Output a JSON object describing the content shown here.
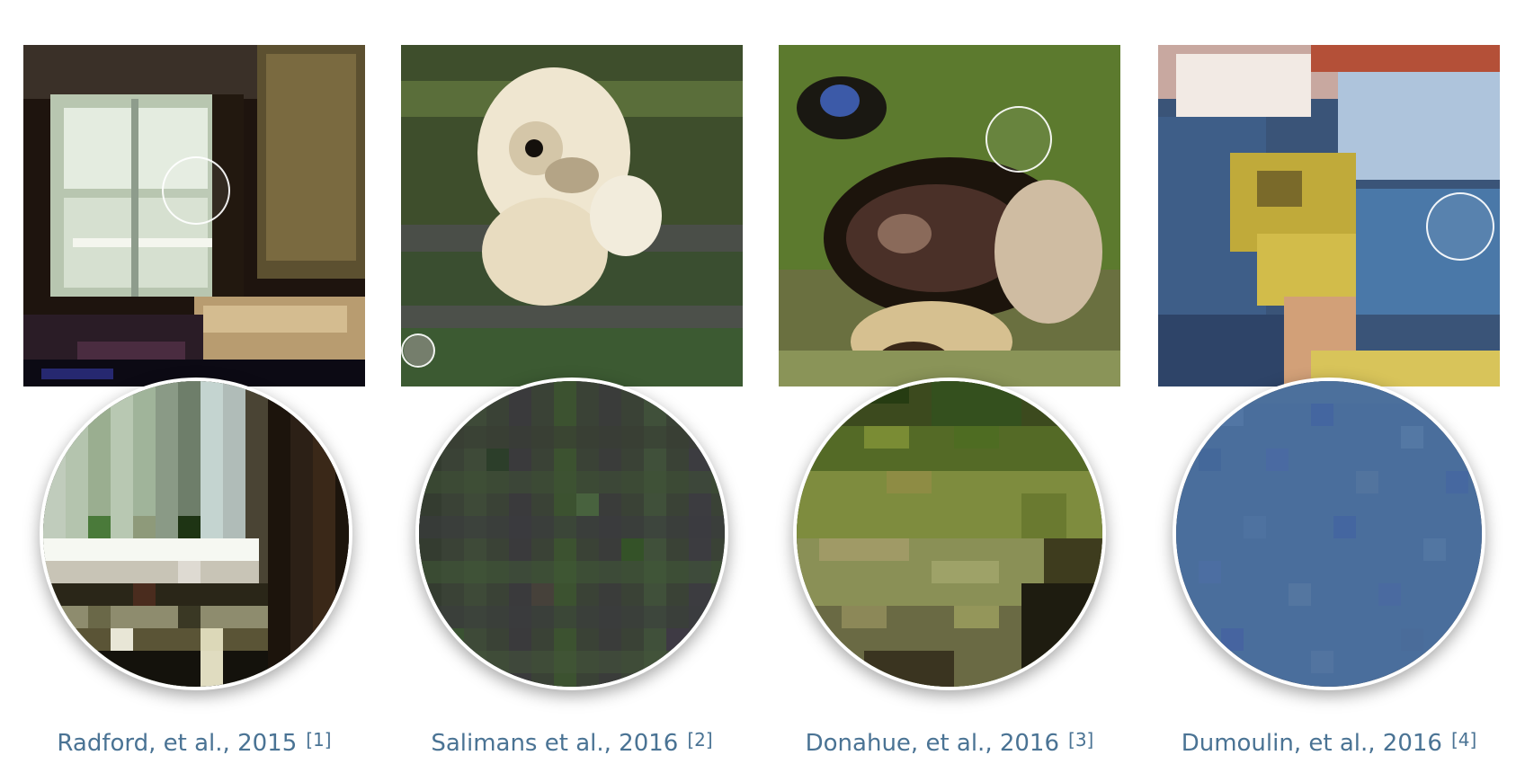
{
  "figures": [
    {
      "caption": "Radford, et al., 2015",
      "ref": "[1]",
      "scene": "bedroom-window",
      "palette": {
        "dark": "#14100c",
        "light": "#d8e4d4",
        "mid": "#8a7a5a",
        "accent": "#3d6b3a"
      }
    },
    {
      "caption": "Salimans et al., 2016",
      "ref": "[2]",
      "scene": "white-animal-fence",
      "palette": {
        "dark": "#343a33",
        "light": "#f1ead7",
        "mid": "#48593d",
        "accent": "#3e5a37"
      }
    },
    {
      "caption": "Donahue, et al., 2016",
      "ref": "[3]",
      "scene": "dog-face",
      "palette": {
        "dark": "#1e1810",
        "light": "#d8c490",
        "mid": "#7e8b3d",
        "accent": "#385c22"
      }
    },
    {
      "caption": "Dumoulin, et al., 2016",
      "ref": "[4]",
      "scene": "blue-yellow-scene",
      "palette": {
        "dark": "#2c3d52",
        "light": "#f0e2dc",
        "mid": "#4a6e9b",
        "accent": "#c3ad3d"
      }
    }
  ]
}
